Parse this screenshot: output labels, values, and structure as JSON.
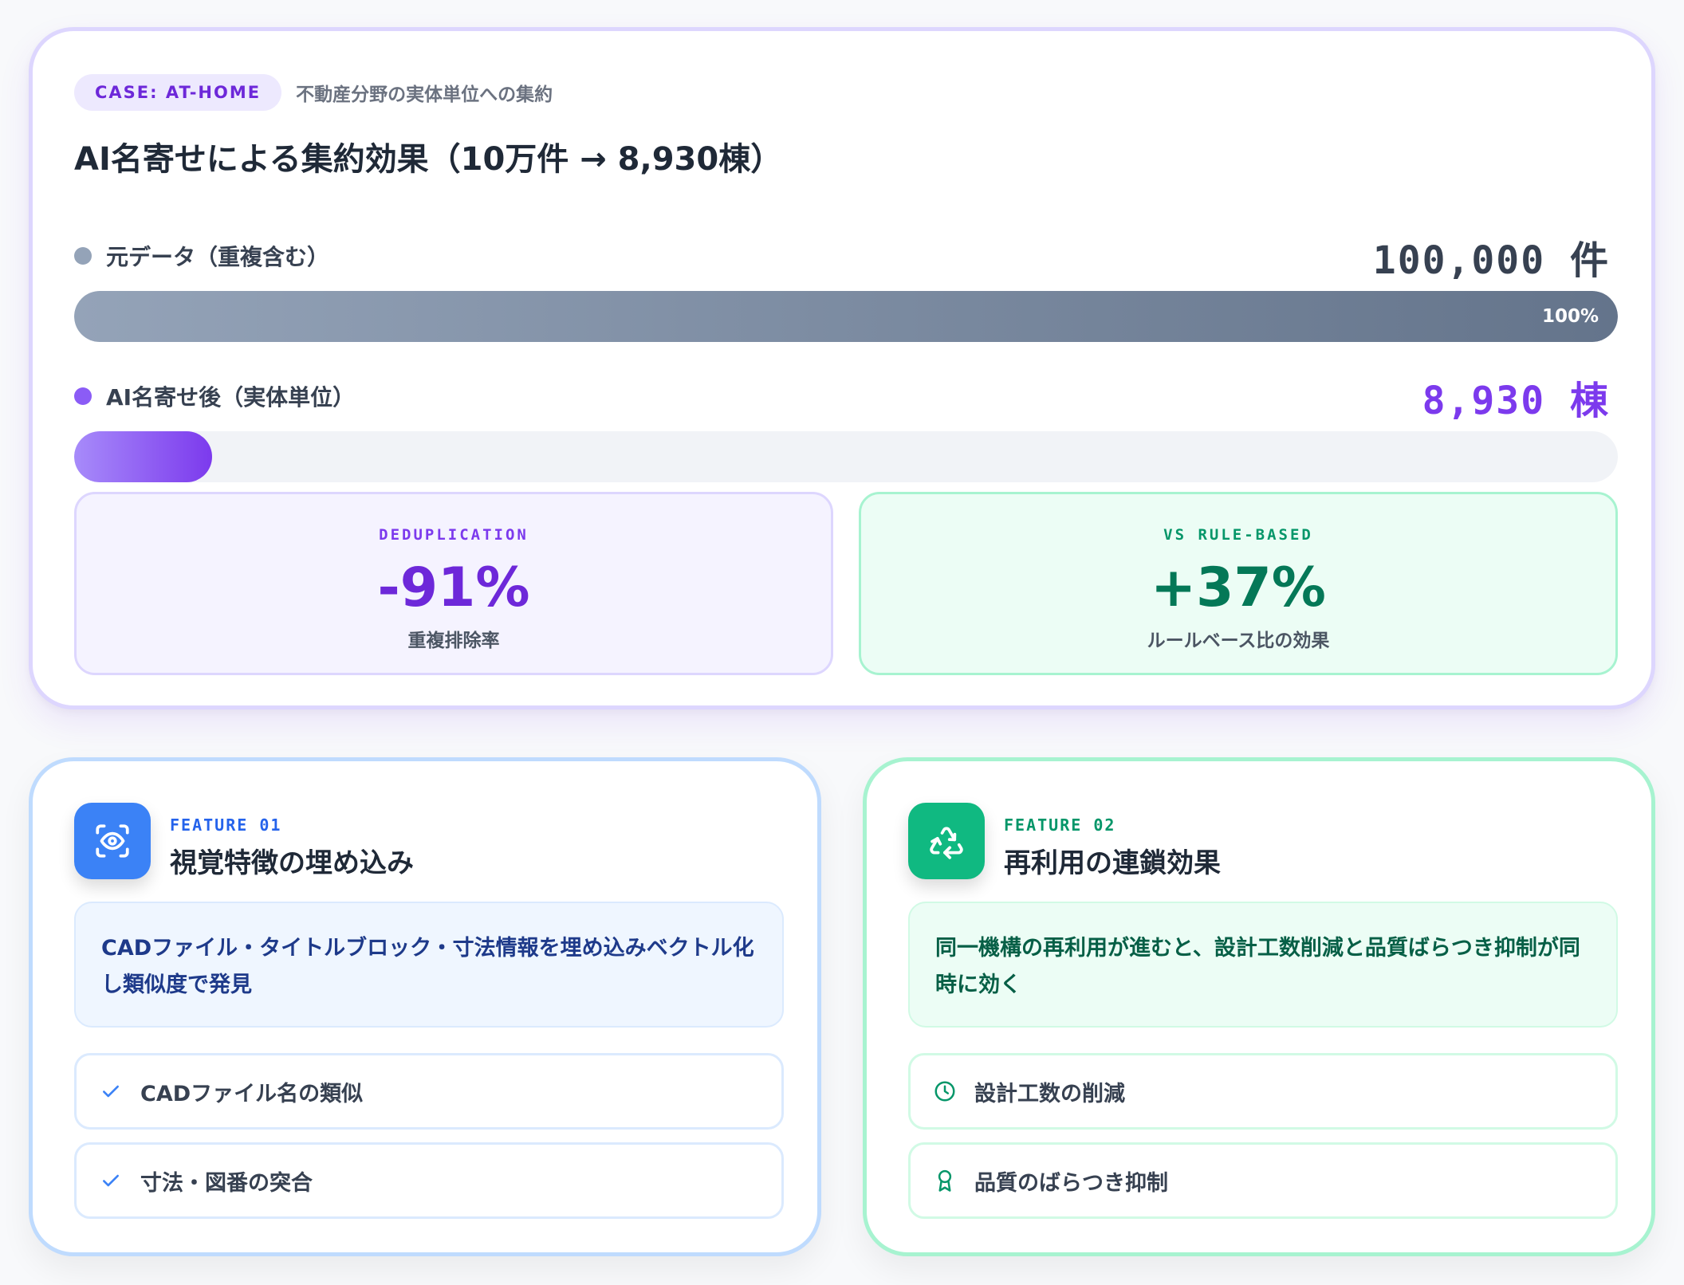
{
  "case": {
    "badge": "CASE: AT-HOME",
    "subtitle": "不動産分野の実体単位への集約"
  },
  "title": "AI名寄せによる集約効果（10万件 → 8,930棟）",
  "bars": [
    {
      "label": "元データ（重複含む）",
      "value": "100,000 件",
      "fill_fraction": 1.0,
      "fill_label": "100%",
      "color": "#94a3b8"
    },
    {
      "label": "AI名寄せ後（実体単位）",
      "value": "8,930 棟",
      "fill_fraction": 0.0893,
      "fill_label": "",
      "color": "#8b5cf6"
    }
  ],
  "stats": [
    {
      "kicker": "DEDUPLICATION",
      "value": "-91%",
      "caption": "重複排除率",
      "color": "#6d28d9"
    },
    {
      "kicker": "VS RULE-BASED",
      "value": "+37%",
      "caption": "ルールベース比の効果",
      "color": "#047857"
    }
  ],
  "features": [
    {
      "kicker": "FEATURE 01",
      "title": "視覚特徴の埋め込み",
      "icon": "eye-scan-icon",
      "description": "CADファイル・タイトルブロック・寸法情報を埋め込みベクトル化し類似度で発見",
      "items": [
        {
          "icon": "check-icon",
          "label": "CADファイル名の類似"
        },
        {
          "icon": "check-icon",
          "label": "寸法・図番の突合"
        }
      ],
      "color": "#3b82f6"
    },
    {
      "kicker": "FEATURE 02",
      "title": "再利用の連鎖効果",
      "icon": "recycle-icon",
      "description": "同一機構の再利用が進むと、設計工数削減と品質ばらつき抑制が同時に効く",
      "items": [
        {
          "icon": "clock-icon",
          "label": "設計工数の削減"
        },
        {
          "icon": "award-icon",
          "label": "品質のばらつき抑制"
        }
      ],
      "color": "#10b981"
    }
  ]
}
